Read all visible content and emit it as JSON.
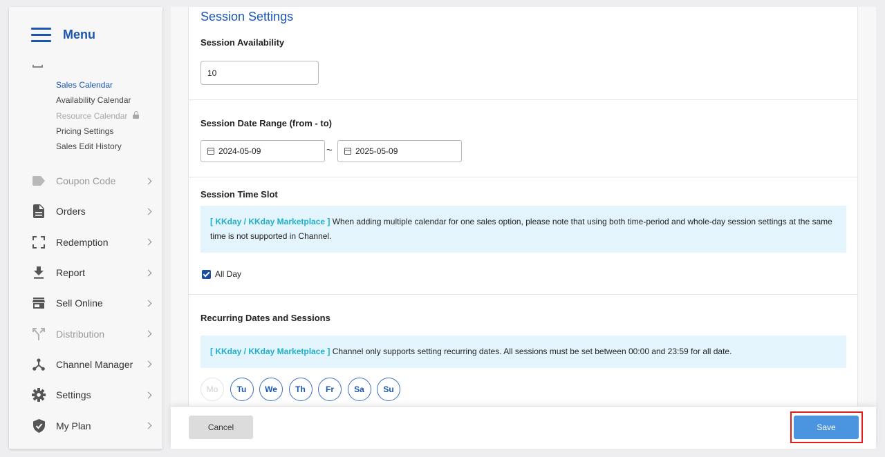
{
  "sidebar": {
    "menu_title": "Menu",
    "subitems": [
      {
        "label": "Sales Calendar"
      },
      {
        "label": "Availability Calendar"
      },
      {
        "label": "Resource Calendar"
      },
      {
        "label": "Pricing Settings"
      },
      {
        "label": "Sales Edit History"
      }
    ],
    "nav": [
      {
        "label": "Coupon Code",
        "icon": "tag-icon"
      },
      {
        "label": "Orders",
        "icon": "document-icon"
      },
      {
        "label": "Redemption",
        "icon": "scan-icon"
      },
      {
        "label": "Report",
        "icon": "download-icon"
      },
      {
        "label": "Sell Online",
        "icon": "store-icon"
      },
      {
        "label": "Distribution",
        "icon": "distribution-icon"
      },
      {
        "label": "Channel Manager",
        "icon": "hub-icon"
      },
      {
        "label": "Settings",
        "icon": "gear-icon"
      },
      {
        "label": "My Plan",
        "icon": "shield-icon"
      }
    ]
  },
  "main": {
    "section_title": "Session Settings",
    "availability": {
      "label": "Session Availability",
      "value": "10"
    },
    "date_range": {
      "label": "Session Date Range (from - to)",
      "from": "2024-05-09",
      "separator": "~",
      "to": "2025-05-09"
    },
    "time_slot": {
      "label": "Session Time Slot",
      "notice_tag": "[ KKday / KKday Marketplace ]",
      "notice_text": " When adding multiple calendar for one sales option, please note that using both time-period and whole-day session settings at the same time is not supported in Channel.",
      "all_day_label": "All Day",
      "all_day_checked": true
    },
    "recurring": {
      "label": "Recurring Dates and Sessions",
      "notice_tag": "[ KKday / KKday Marketplace ]",
      "notice_text": " Channel only supports setting recurring dates. All sessions must be set between 00:00 and 23:59 for all date.",
      "days": [
        {
          "label": "Mo",
          "enabled": false
        },
        {
          "label": "Tu",
          "enabled": true
        },
        {
          "label": "We",
          "enabled": true
        },
        {
          "label": "Th",
          "enabled": true
        },
        {
          "label": "Fr",
          "enabled": true
        },
        {
          "label": "Sa",
          "enabled": true
        },
        {
          "label": "Su",
          "enabled": true
        }
      ]
    }
  },
  "footer": {
    "cancel_label": "Cancel",
    "save_label": "Save"
  },
  "colors": {
    "accent": "#1a56b0",
    "save": "#4a94e0",
    "notice_bg": "#e4f4fc",
    "notice_tag": "#1eb0c8",
    "highlight": "#e31c1c"
  }
}
